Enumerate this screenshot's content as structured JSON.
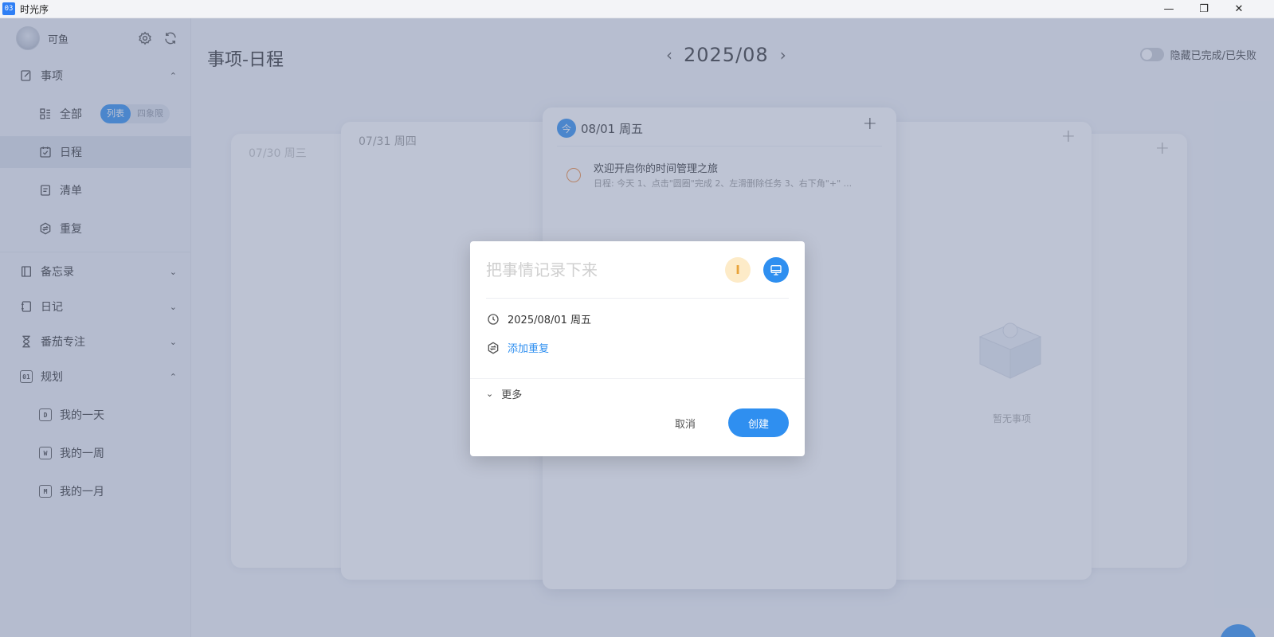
{
  "window": {
    "app_icon_text": "03",
    "title": "时光序",
    "controls": {
      "minimize": "—",
      "restore": "❐",
      "close": "✕"
    }
  },
  "sidebar": {
    "user_name": "可鱼",
    "sections": {
      "tasks": {
        "label": "事项",
        "chevron": "⌃"
      },
      "all": {
        "label": "全部",
        "segment": [
          "列表",
          "四象限"
        ]
      },
      "schedule": {
        "label": "日程"
      },
      "checklist": {
        "label": "清单"
      },
      "repeat": {
        "label": "重复"
      },
      "memo": {
        "label": "备忘录",
        "chevron": "⌄"
      },
      "diary": {
        "label": "日记",
        "chevron": "⌄"
      },
      "pomodoro": {
        "label": "番茄专注",
        "chevron": "⌄"
      },
      "plan": {
        "label": "规划",
        "chevron": "⌃",
        "badge": "01"
      },
      "my_day": {
        "label": "我的一天",
        "badge": "D"
      },
      "my_week": {
        "label": "我的一周",
        "badge": "W"
      },
      "my_month": {
        "label": "我的一月",
        "badge": "M"
      }
    }
  },
  "main": {
    "page_title": "事项-日程",
    "month": "2025/08",
    "prev_arrow": "‹",
    "next_arrow": "›",
    "hide_toggle_label": "隐藏已完成/已失败",
    "cards": {
      "d0730": "07/30 周三",
      "d0731": "07/31 周四",
      "today": {
        "badge": "今",
        "date": "08/01 周五"
      },
      "plus": "+"
    },
    "task": {
      "title": "欢迎开启你的时间管理之旅",
      "subtitle": "日程: 今天 1、点击\"圆圈\"完成 2、左滑删除任务 3、右下角\"+\" ..."
    },
    "empty_text": "暂无事项"
  },
  "dialog": {
    "placeholder": "把事情记录下来",
    "date_text": "2025/08/01 周五",
    "add_repeat": "添加重复",
    "more": "更多",
    "more_chevron": "⌄",
    "cancel": "取消",
    "create": "创建",
    "priority_glyph": "I",
    "colors": {
      "accent": "#2f8ff0",
      "priority_bg": "#fdebc8",
      "priority_fg": "#e8a33a"
    }
  }
}
